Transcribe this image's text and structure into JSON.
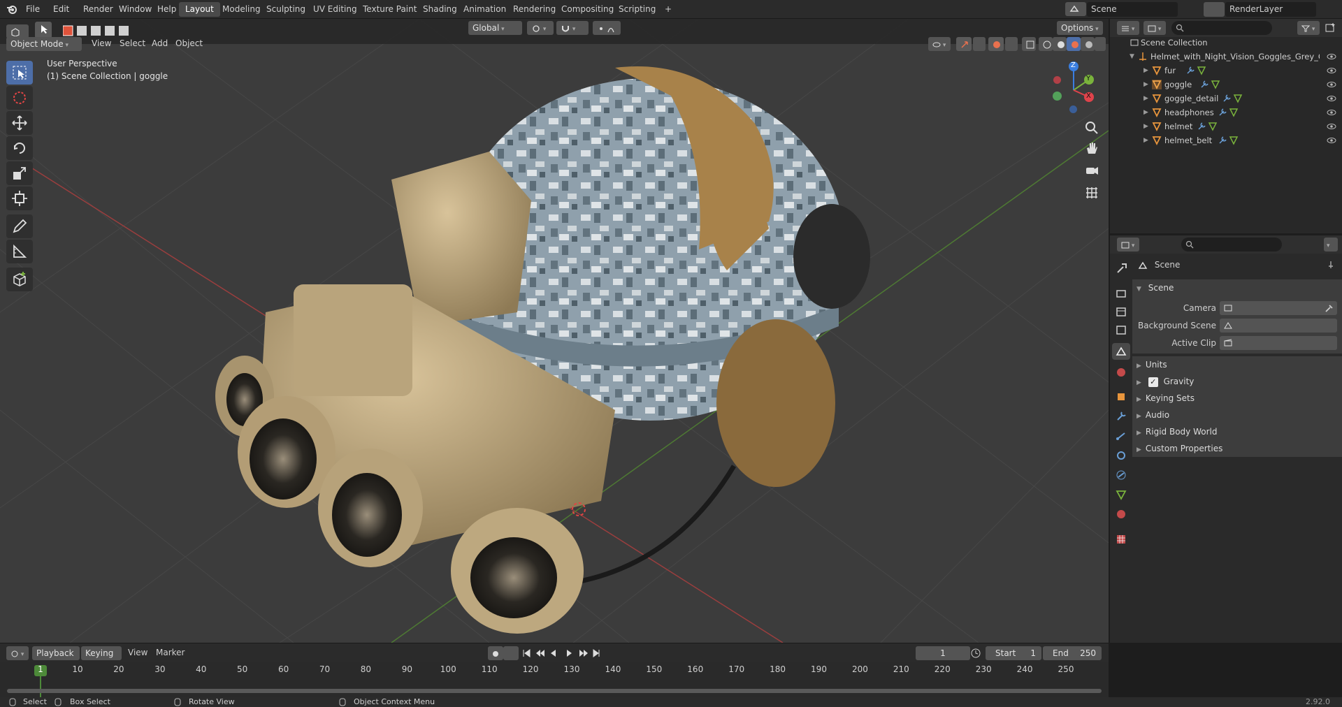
{
  "topbar": {
    "menus": [
      "File",
      "Edit",
      "Render",
      "Window",
      "Help"
    ],
    "workspaces": [
      "Layout",
      "Modeling",
      "Sculpting",
      "UV Editing",
      "Texture Paint",
      "Shading",
      "Animation",
      "Rendering",
      "Compositing",
      "Scripting"
    ],
    "active_workspace": "Layout",
    "add_tab": "+",
    "scene_name": "Scene",
    "view_layer": "RenderLayer"
  },
  "viewport_header": {
    "mode": "Object Mode",
    "menus": [
      "View",
      "Select",
      "Add",
      "Object"
    ],
    "transform_orientation": "Global",
    "options_label": "Options"
  },
  "viewport": {
    "overlay_line1": "User Perspective",
    "overlay_line2": "(1) Scene Collection | goggle",
    "gizmo_axes": {
      "x": "X",
      "y": "Y",
      "z": "Z"
    }
  },
  "outliner": {
    "root": "Scene Collection",
    "collection": "Helmet_with_Night_Vision_Goggles_Grey_C",
    "objects": [
      "fur",
      "goggle",
      "goggle_detail",
      "headphones",
      "helmet",
      "helmet_belt"
    ],
    "selected": "goggle"
  },
  "properties": {
    "breadcrumb": "Scene",
    "scene_panel": "Scene",
    "fields": [
      {
        "label": "Camera",
        "value": ""
      },
      {
        "label": "Background Scene",
        "value": ""
      },
      {
        "label": "Active Clip",
        "value": ""
      }
    ],
    "subpanels": [
      "Units",
      "Gravity",
      "Keying Sets",
      "Audio",
      "Rigid Body World",
      "Custom Properties"
    ],
    "gravity_checked": true
  },
  "timeline": {
    "menus": [
      "Playback",
      "Keying",
      "View",
      "Marker"
    ],
    "current_frame": "1",
    "start_label": "Start",
    "start": "1",
    "end_label": "End",
    "end": "250",
    "ticks": [
      "1",
      "10",
      "20",
      "30",
      "40",
      "50",
      "60",
      "70",
      "80",
      "90",
      "100",
      "110",
      "120",
      "130",
      "140",
      "150",
      "160",
      "170",
      "180",
      "190",
      "200",
      "210",
      "220",
      "230",
      "240",
      "250"
    ]
  },
  "statusbar": {
    "items": [
      "Select",
      "Box Select",
      "Rotate View",
      "Object Context Menu"
    ],
    "version": "2.92.0"
  },
  "colors": {
    "accent": "#4d6ea8",
    "object_orange": "#e8953c",
    "eye": "#b8b8b8",
    "x_axis": "#e0434b",
    "y_axis": "#7ab33c",
    "z_axis": "#3a7ee0"
  }
}
